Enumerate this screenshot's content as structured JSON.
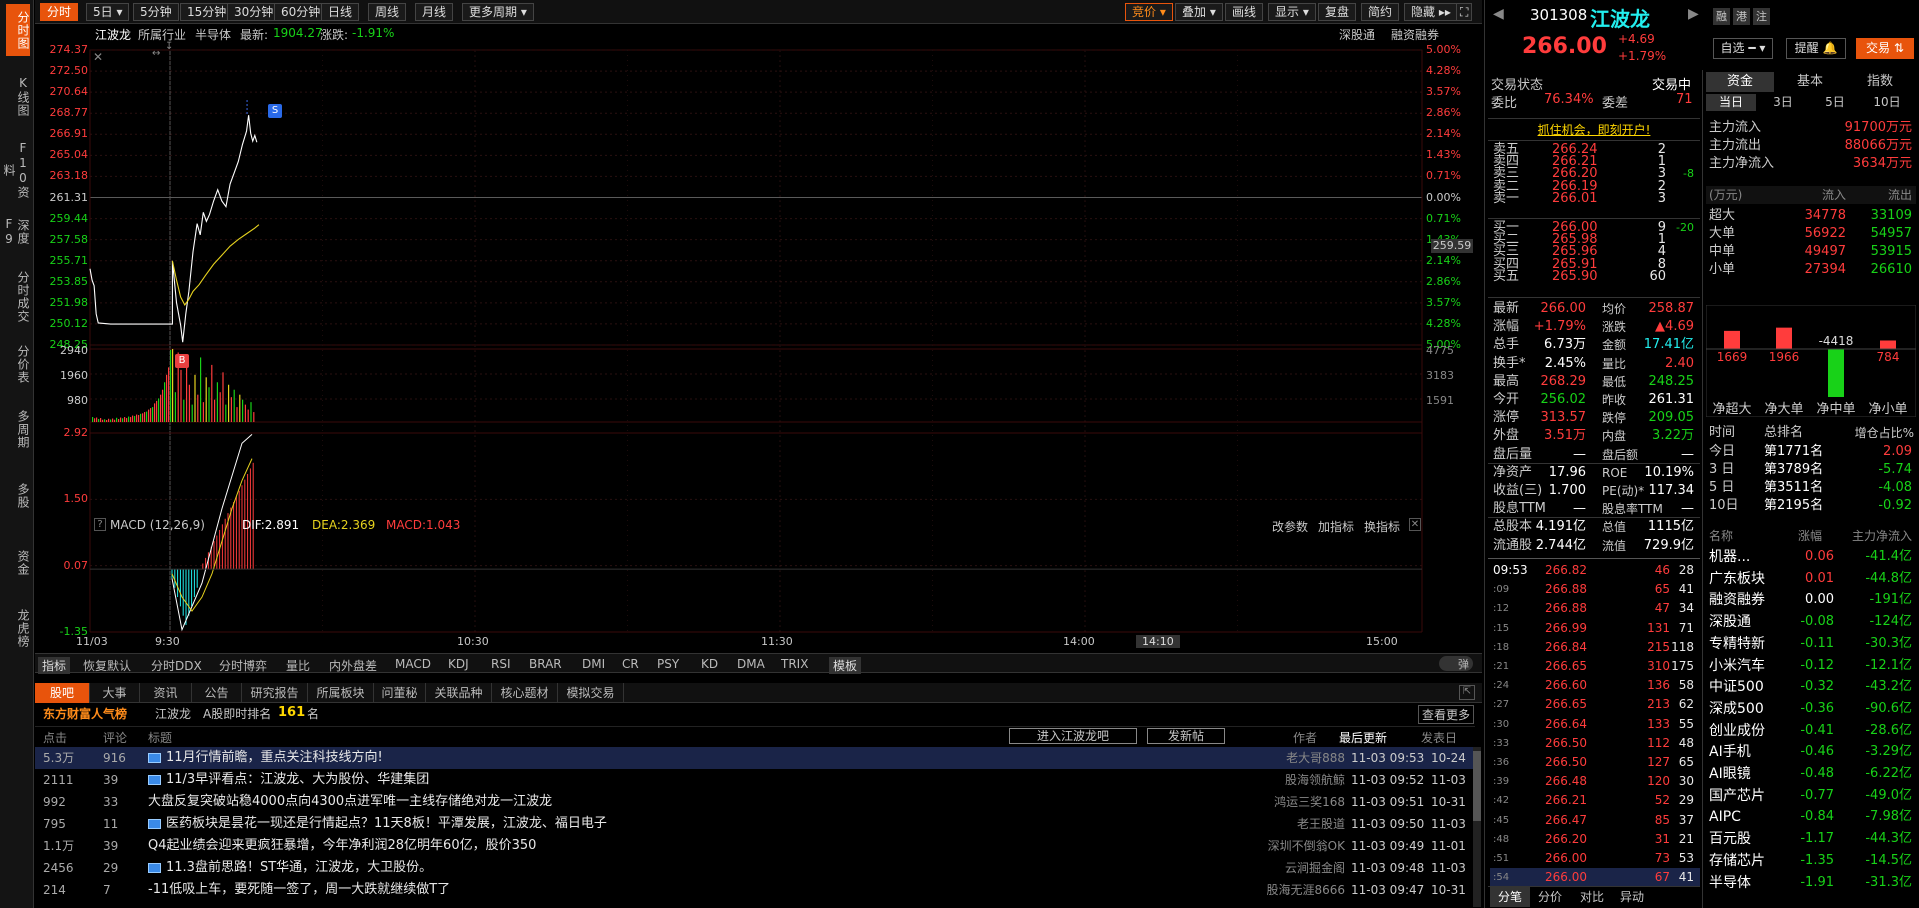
{
  "left_nav": [
    "分时图",
    "K线图",
    "F10资料",
    "深度F9",
    "分时成交",
    "分价表",
    "多周期",
    "多股",
    "资金",
    "龙虎榜"
  ],
  "period_tabs": [
    "分时",
    "5日",
    "5分钟",
    "15分钟",
    "30分钟",
    "60分钟",
    "日线",
    "周线",
    "月线",
    "更多周期"
  ],
  "tool_tabs": [
    "竞价",
    "叠加",
    "画线",
    "显示",
    "复盘",
    "简约",
    "隐藏"
  ],
  "info": {
    "name": "江波龙",
    "industry_label": "所属行业",
    "industry": "半导体",
    "latest_label": "最新:",
    "latest": "1904.27",
    "change_label": "涨跌:",
    "change": "-1.91%",
    "right1": "深股通",
    "right2": "融资融券"
  },
  "price_axis": {
    "left": [
      "274.37",
      "272.50",
      "270.64",
      "268.77",
      "266.91",
      "265.04",
      "263.18",
      "261.31",
      "259.44",
      "257.58",
      "255.71",
      "253.85",
      "251.98",
      "250.12",
      "248.25"
    ],
    "right": [
      "5.00%",
      "4.28%",
      "3.57%",
      "2.86%",
      "2.14%",
      "1.43%",
      "0.71%",
      "0.00%",
      "0.71%",
      "1.43%",
      "2.14%",
      "2.86%",
      "3.57%",
      "4.28%",
      "5.00%"
    ],
    "avg_label": "259.59"
  },
  "vol_axis": {
    "left": [
      "2940",
      "1960",
      "980"
    ],
    "right": [
      "4775",
      "3183",
      "1591"
    ]
  },
  "macd_axis": {
    "left": [
      "2.92",
      "1.50",
      "0.07",
      "-1.35"
    ]
  },
  "macd_info": {
    "title": "MACD (12,26,9)",
    "dif": "DIF:2.891",
    "dea": "DEA:2.369",
    "macd": "MACD:1.043",
    "btn1": "改参数",
    "btn2": "加指标",
    "btn3": "换指标"
  },
  "time_axis": [
    "11/03",
    "9:30",
    "10:30",
    "11:30",
    "14:00",
    "14:10",
    "15:00"
  ],
  "markers": {
    "s": "S",
    "b": "B"
  },
  "indicators": [
    "指标",
    "恢复默认",
    "分时DDX",
    "分时博弈",
    "量比",
    "内外盘差",
    "MACD",
    "KDJ",
    "RSI",
    "BRAR",
    "DMI",
    "CR",
    "PSY",
    "KD",
    "DMA",
    "TRIX",
    "模板"
  ],
  "bullet_label": "弹",
  "bottom_tabs": [
    "股吧",
    "大事",
    "资讯",
    "公告",
    "研究报告",
    "所属板块",
    "问董秘",
    "关联品种",
    "核心题材",
    "模拟交易"
  ],
  "popularity": {
    "label": "东方财富人气榜",
    "name": "江波龙",
    "rank_label": "A股即时排名",
    "rank": "161",
    "unit": "名",
    "more": "查看更多"
  },
  "news_header": {
    "click": "点击",
    "comment": "评论",
    "title": "标题",
    "enter": "进入江波龙吧",
    "post": "发新帖",
    "author": "作者",
    "latest": "最后更新",
    "post_date": "发表日"
  },
  "news": [
    {
      "click": "5.3万",
      "comment": "916",
      "title": "11月行情前瞻，重点关注科技线方向!",
      "author": "老大哥888",
      "update": "11-03 09:53",
      "date": "10-24",
      "hl": true
    },
    {
      "click": "2111",
      "comment": "39",
      "title": "11/3早评看点：江波龙、大为股份、华建集团",
      "author": "股海领航鲸",
      "update": "11-03 09:52",
      "date": "11-03"
    },
    {
      "click": "992",
      "comment": "33",
      "title": "大盘反复突破站稳4000点向4300点进军唯一主线存储绝对龙一江波龙",
      "author": "鸿运三奖168",
      "update": "11-03 09:51",
      "date": "10-31"
    },
    {
      "click": "795",
      "comment": "11",
      "title": "医药板块是昙花一现还是行情起点？11天8板！平潭发展，江波龙、福日电子",
      "author": "老王股道",
      "update": "11-03 09:50",
      "date": "11-03"
    },
    {
      "click": "1.1万",
      "comment": "39",
      "title": "Q4起业绩会迎来更疯狂暴增，今年净利润28亿明年60亿，股价350",
      "author": "深圳不倒翁OK",
      "update": "11-03 09:49",
      "date": "11-01"
    },
    {
      "click": "2456",
      "comment": "29",
      "title": "11.3盘前思路！ST华通，江波龙，大卫股份。",
      "author": "云涧掘金阁",
      "update": "11-03 09:48",
      "date": "11-03"
    },
    {
      "click": "214",
      "comment": "7",
      "title": "-11低吸上车，要死随一签了，周一大跌就继续做T了",
      "author": "股海无涯8666",
      "update": "11-03 09:47",
      "date": "10-31"
    }
  ],
  "quote": {
    "code": "301308",
    "name": "江波龙",
    "price": "266.00",
    "chg": "+4.69",
    "pct": "+1.79%",
    "btn_zixuan": "自选",
    "btn_remind": "提醒",
    "btn_trade": "交易",
    "icons": [
      "融",
      "港",
      "注"
    ]
  },
  "trade_status": {
    "label": "交易状态",
    "value": "交易中",
    "weibi_label": "委比",
    "weibi": "76.34%",
    "weicha_label": "委差",
    "weicha": "71",
    "promo": "抓住机会，即刻开户!"
  },
  "sells": [
    {
      "l": "卖五",
      "p": "266.24",
      "v": "2",
      "c": ""
    },
    {
      "l": "卖四",
      "p": "266.21",
      "v": "1",
      "c": ""
    },
    {
      "l": "卖三",
      "p": "266.20",
      "v": "3",
      "c": "-8"
    },
    {
      "l": "卖二",
      "p": "266.19",
      "v": "2",
      "c": ""
    },
    {
      "l": "卖一",
      "p": "266.01",
      "v": "3",
      "c": ""
    }
  ],
  "buys": [
    {
      "l": "买一",
      "p": "266.00",
      "v": "9",
      "c": "-20"
    },
    {
      "l": "买二",
      "p": "265.98",
      "v": "1",
      "c": ""
    },
    {
      "l": "买三",
      "p": "265.96",
      "v": "4",
      "c": ""
    },
    {
      "l": "买四",
      "p": "265.91",
      "v": "8",
      "c": ""
    },
    {
      "l": "买五",
      "p": "265.90",
      "v": "60",
      "c": ""
    }
  ],
  "stats": [
    [
      "最新",
      "266.00",
      "均价",
      "258.87"
    ],
    [
      "涨幅",
      "+1.79%",
      "涨跌",
      "▲4.69"
    ],
    [
      "总手",
      "6.73万",
      "金额",
      "17.41亿"
    ],
    [
      "换手*",
      "2.45%",
      "量比",
      "2.40"
    ],
    [
      "最高",
      "268.29",
      "最低",
      "248.25"
    ],
    [
      "今开",
      "256.02",
      "昨收",
      "261.31"
    ],
    [
      "涨停",
      "313.57",
      "跌停",
      "209.05"
    ],
    [
      "外盘",
      "3.51万",
      "内盘",
      "3.22万"
    ],
    [
      "盘后量",
      "—",
      "盘后额",
      "—"
    ],
    [
      "净资产",
      "17.96",
      "ROE",
      "10.19%"
    ],
    [
      "收益(三)",
      "1.700",
      "PE(动)*",
      "117.34"
    ],
    [
      "股息TTM",
      "—",
      "股息率TTM",
      "—"
    ],
    [
      "总股本",
      "4.191亿",
      "总值",
      "1115亿"
    ],
    [
      "流通股",
      "2.744亿",
      "流值",
      "729.9亿"
    ]
  ],
  "ticks": [
    {
      "t": "09:53",
      "p": "266.82",
      "v": "46",
      "n": "28"
    },
    {
      "t": ":09",
      "p": "266.88",
      "v": "65",
      "n": "41"
    },
    {
      "t": ":12",
      "p": "266.88",
      "v": "47",
      "n": "34"
    },
    {
      "t": ":15",
      "p": "266.99",
      "v": "131",
      "n": "71"
    },
    {
      "t": ":18",
      "p": "266.84",
      "v": "215",
      "n": "118"
    },
    {
      "t": ":21",
      "p": "266.65",
      "v": "310",
      "n": "175"
    },
    {
      "t": ":24",
      "p": "266.60",
      "v": "136",
      "n": "58"
    },
    {
      "t": ":27",
      "p": "266.65",
      "v": "213",
      "n": "62"
    },
    {
      "t": ":30",
      "p": "266.64",
      "v": "133",
      "n": "55"
    },
    {
      "t": ":33",
      "p": "266.50",
      "v": "112",
      "n": "48"
    },
    {
      "t": ":36",
      "p": "266.50",
      "v": "127",
      "n": "65"
    },
    {
      "t": ":39",
      "p": "266.48",
      "v": "120",
      "n": "30"
    },
    {
      "t": ":42",
      "p": "266.21",
      "v": "52",
      "n": "29"
    },
    {
      "t": ":45",
      "p": "266.47",
      "v": "85",
      "n": "37"
    },
    {
      "t": ":48",
      "p": "266.20",
      "v": "31",
      "n": "21"
    },
    {
      "t": ":51",
      "p": "266.00",
      "v": "73",
      "n": "53"
    },
    {
      "t": ":54",
      "p": "266.00",
      "v": "67",
      "n": "41"
    }
  ],
  "tick_tabs": [
    "分笔",
    "分价",
    "对比",
    "异动"
  ],
  "fund_tabs": [
    "资金",
    "基本",
    "指数"
  ],
  "fund_sub": [
    "当日",
    "3日",
    "5日",
    "10日"
  ],
  "fund_flow": [
    [
      "主力流入",
      "91700万元"
    ],
    [
      "主力流出",
      "88066万元"
    ],
    [
      "主力净流入",
      "3634万元"
    ]
  ],
  "fund_table_header": [
    "(万元)",
    "流入",
    "流出"
  ],
  "fund_table": [
    [
      "超大",
      "34778",
      "33109"
    ],
    [
      "大单",
      "56922",
      "54957"
    ],
    [
      "中单",
      "49497",
      "53915"
    ],
    [
      "小单",
      "27394",
      "26610"
    ]
  ],
  "net_bars": {
    "values": [
      1669,
      1966,
      -4418,
      784
    ],
    "labels": [
      "1669",
      "1966",
      "-4418",
      "784"
    ],
    "names": [
      "净超大",
      "净大单",
      "净中单",
      "净小单"
    ]
  },
  "rank_header": [
    "时间",
    "总排名",
    "增仓占比%"
  ],
  "ranks": [
    [
      "今日",
      "第1771名",
      "2.09"
    ],
    [
      "3 日",
      "第3789名",
      "-5.74"
    ],
    [
      "5 日",
      "第3511名",
      "-4.08"
    ],
    [
      "10日",
      "第2195名",
      "-0.92"
    ]
  ],
  "sector_header": [
    "名称",
    "涨幅",
    "主力净流入"
  ],
  "sectors": [
    [
      "机器...",
      "0.06",
      "-41.4亿"
    ],
    [
      "广东板块",
      "0.01",
      "-44.8亿"
    ],
    [
      "融资融券",
      "0.00",
      "-191亿"
    ],
    [
      "深股通",
      "-0.08",
      "-124亿"
    ],
    [
      "专精特新",
      "-0.11",
      "-30.3亿"
    ],
    [
      "小米汽车",
      "-0.12",
      "-12.1亿"
    ],
    [
      "中证500",
      "-0.32",
      "-43.2亿"
    ],
    [
      "深成500",
      "-0.36",
      "-90.6亿"
    ],
    [
      "创业成份",
      "-0.41",
      "-28.6亿"
    ],
    [
      "AI手机",
      "-0.46",
      "-3.29亿"
    ],
    [
      "AI眼镜",
      "-0.48",
      "-6.22亿"
    ],
    [
      "国产芯片",
      "-0.77",
      "-49.0亿"
    ],
    [
      "AIPC",
      "-0.84",
      "-7.98亿"
    ],
    [
      "百元股",
      "-1.17",
      "-44.3亿"
    ],
    [
      "存储芯片",
      "-1.35",
      "-14.5亿"
    ],
    [
      "半导体",
      "-1.91",
      "-31.3亿"
    ]
  ],
  "colors": {
    "up": "#ff3c3c",
    "down": "#18d218",
    "accent": "#e8540c",
    "price_line": "#ffffff",
    "avg_line": "#e6d21e",
    "bg": "#000000"
  }
}
